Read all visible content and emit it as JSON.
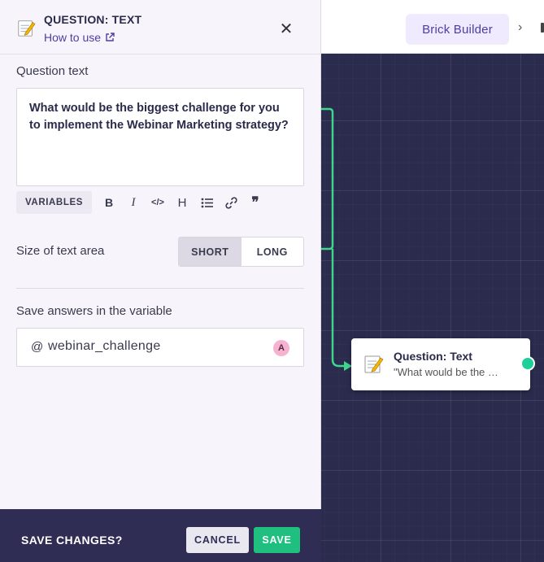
{
  "topbar": {
    "brick_builder_label": "Brick Builder",
    "chevron": "›"
  },
  "node": {
    "title": "Question: Text",
    "subtitle": "\"What would be the …",
    "icon": "memo-icon"
  },
  "panel": {
    "title": "QUESTION: TEXT",
    "how_to_use": "How to use",
    "close": "✕",
    "question_label": "Question text",
    "question_text": "What would be the biggest challenge for you to implement the Webinar Marketing strategy?",
    "toolbar": {
      "variables": "VARIABLES",
      "bold": "B",
      "italic": "I",
      "code": "</>",
      "heading": "H",
      "quote": "❞"
    },
    "size_label": "Size of text area",
    "size_options": [
      "SHORT",
      "LONG"
    ],
    "size_selected": "SHORT",
    "variable_label": "Save answers in the variable",
    "variable_prefix": "@",
    "variable_value": "webinar_challenge",
    "variable_badge": "A"
  },
  "footer": {
    "prompt": "SAVE CHANGES?",
    "cancel": "CANCEL",
    "save": "SAVE"
  },
  "colors": {
    "accent": "#4b3ea8",
    "canvas": "#2b2b4d",
    "connector": "#3dd68c",
    "save": "#1fbf7f",
    "footer": "#2f2d54"
  }
}
